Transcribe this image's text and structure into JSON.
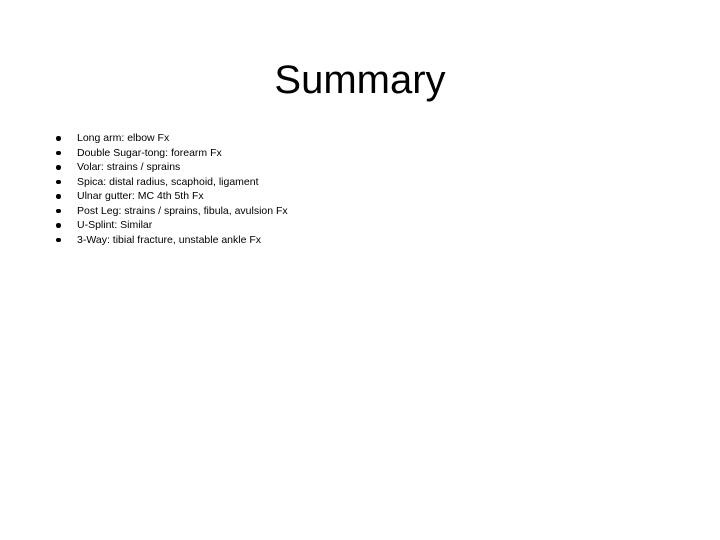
{
  "slide": {
    "title": "Summary",
    "background_color": "#ffffff",
    "text_color": "#000000",
    "bullet_glyph": "filled-round-bullet",
    "bullets": [
      {
        "text": "Long arm: elbow Fx"
      },
      {
        "text": "Double Sugar-tong: forearm Fx"
      },
      {
        "text": "Volar: strains / sprains"
      },
      {
        "text": "Spica: distal radius, scaphoid, ligament"
      },
      {
        "text": "Ulnar gutter: MC 4th 5th Fx"
      },
      {
        "text": "Post Leg: strains / sprains, fibula, avulsion Fx"
      },
      {
        "text": "U-Splint: Similar"
      },
      {
        "text": "3-Way: tibial fracture, unstable ankle Fx"
      }
    ]
  }
}
